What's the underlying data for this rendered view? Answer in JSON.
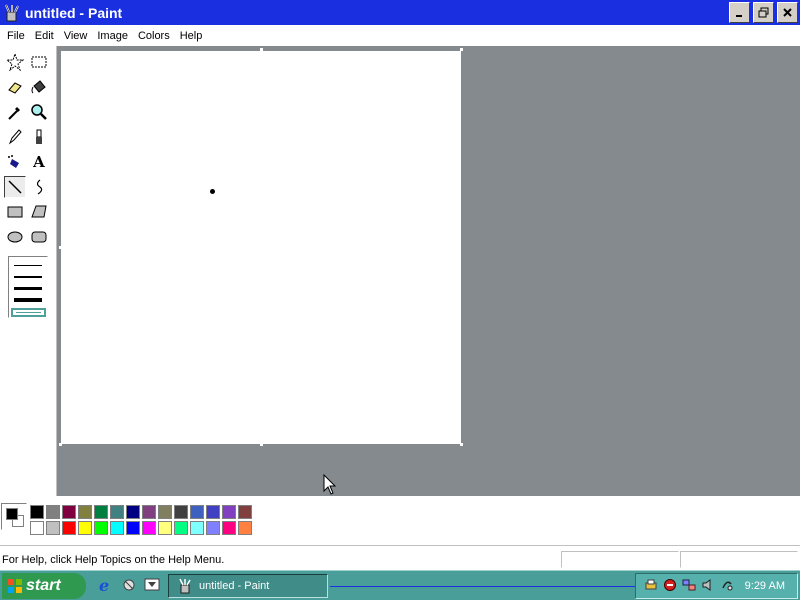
{
  "window": {
    "title": "untitled - Paint",
    "app_icon": "paint-bucket-brush-icon",
    "buttons": [
      "minimize-icon",
      "restore-icon",
      "close-icon"
    ]
  },
  "menu": {
    "items": [
      "File",
      "Edit",
      "View",
      "Image",
      "Colors",
      "Help"
    ]
  },
  "tools": [
    {
      "name": "free-form-select",
      "icon": "star-select-icon"
    },
    {
      "name": "select",
      "icon": "dashed-rect-icon"
    },
    {
      "name": "eraser",
      "icon": "eraser-icon"
    },
    {
      "name": "fill-with-color",
      "icon": "paint-bucket-icon"
    },
    {
      "name": "pick-color",
      "icon": "eyedropper-icon"
    },
    {
      "name": "magnifier",
      "icon": "magnifier-icon"
    },
    {
      "name": "pencil",
      "icon": "pencil-icon"
    },
    {
      "name": "brush",
      "icon": "brush-icon"
    },
    {
      "name": "airbrush",
      "icon": "airbrush-icon"
    },
    {
      "name": "text",
      "icon": "text-icon",
      "glyph": "A"
    },
    {
      "name": "line",
      "icon": "line-icon",
      "active": true
    },
    {
      "name": "curve",
      "icon": "curve-icon"
    },
    {
      "name": "rectangle",
      "icon": "rectangle-icon"
    },
    {
      "name": "polygon",
      "icon": "polygon-icon"
    },
    {
      "name": "ellipse",
      "icon": "ellipse-icon"
    },
    {
      "name": "rounded-rectangle",
      "icon": "rounded-rect-icon"
    }
  ],
  "palette": {
    "foreground": "#000000",
    "background": "#ffffff",
    "row1": [
      "#000000",
      "#808080",
      "#800040",
      "#808040",
      "#008040",
      "#408080",
      "#000080",
      "#804080",
      "#808060",
      "#404040",
      "#4060c0",
      "#4040c0",
      "#8040c0",
      "#804040"
    ],
    "row2": [
      "#ffffff",
      "#c0c0c0",
      "#ff0000",
      "#ffff00",
      "#00ff00",
      "#00ffff",
      "#0000ff",
      "#ff00ff",
      "#ffff80",
      "#00ff80",
      "#80ffff",
      "#8080ff",
      "#ff0080",
      "#ff8040"
    ]
  },
  "status": {
    "text": "For Help, click Help Topics on the Help Menu."
  },
  "taskbar": {
    "start_label": "start",
    "task_label": "untitled - Paint",
    "quick_launch": [
      "ie-icon",
      "outlook-icon",
      "desktop-icon"
    ],
    "tray_icons": [
      "printer-icon",
      "shield-icon",
      "network-icon",
      "speaker-icon",
      "tray-app-icon"
    ],
    "clock": "9:29 AM"
  },
  "colors": {
    "titlebar": "#1a2fe0",
    "workspace": "#858a8f",
    "taskbar": "#4a9e9a"
  }
}
